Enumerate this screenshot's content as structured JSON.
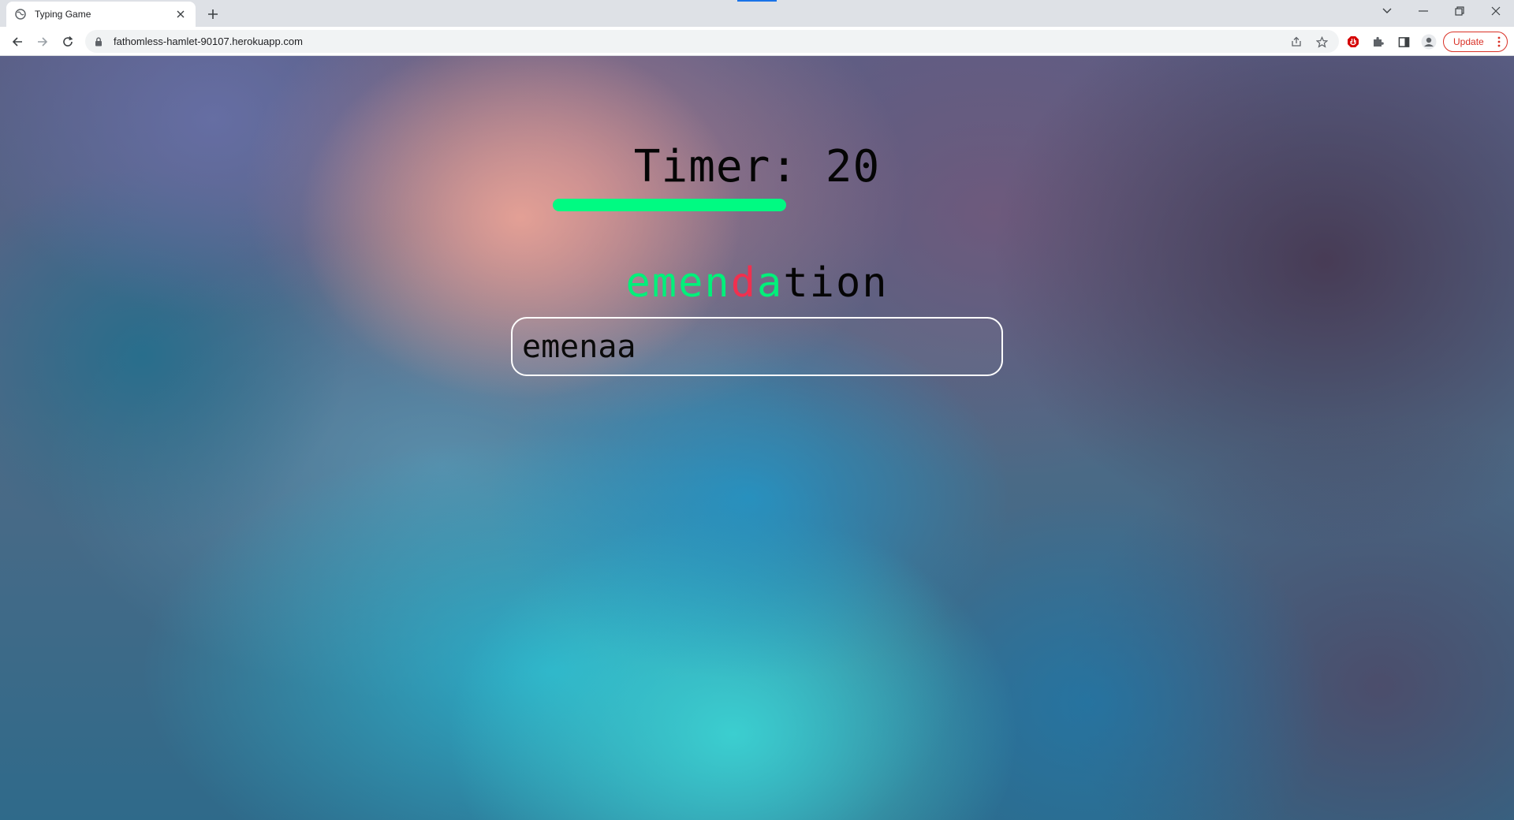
{
  "browser": {
    "tab_title": "Typing Game",
    "url": "fathomless-hamlet-90107.herokuapp.com",
    "update_label": "Update",
    "icons": [
      "globe-icon",
      "close-icon",
      "plus-icon",
      "chevron-down-icon",
      "minimize-icon",
      "restore-icon",
      "close-window-icon",
      "back-icon",
      "forward-icon",
      "reload-icon",
      "lock-icon",
      "share-icon",
      "star-icon",
      "adblock-icon",
      "extensions-icon",
      "side-panel-icon",
      "profile-icon",
      "more-icon"
    ]
  },
  "game": {
    "timer_label": "Timer: 20",
    "timer_value": 20,
    "progress_fraction": 0.81,
    "progress_color": "#00fa82",
    "word": "emendation",
    "word_letters": [
      {
        "ch": "e",
        "state": "correct"
      },
      {
        "ch": "m",
        "state": "correct"
      },
      {
        "ch": "e",
        "state": "correct"
      },
      {
        "ch": "n",
        "state": "correct"
      },
      {
        "ch": "d",
        "state": "wrong"
      },
      {
        "ch": "a",
        "state": "correct"
      },
      {
        "ch": "t",
        "state": "pending"
      },
      {
        "ch": "i",
        "state": "pending"
      },
      {
        "ch": "o",
        "state": "pending"
      },
      {
        "ch": "n",
        "state": "pending"
      }
    ],
    "input_value": "emenaa",
    "colors": {
      "correct": "#00f07a",
      "wrong": "#f0304f",
      "pending": "#050505"
    }
  }
}
